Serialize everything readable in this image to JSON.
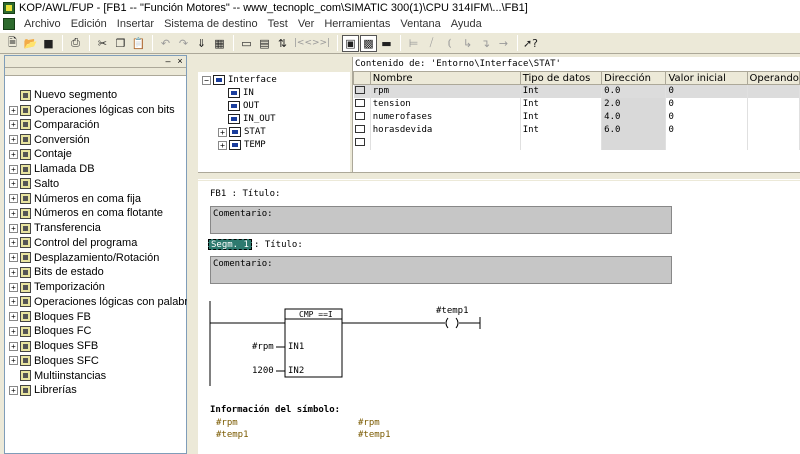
{
  "window": {
    "title": "KOP/AWL/FUP  - [FB1 -- \"Función Motores\" -- www_tecnoplc_com\\SIMATIC 300(1)\\CPU 314IFM\\...\\FB1]"
  },
  "menu": {
    "items": [
      "Archivo",
      "Edición",
      "Insertar",
      "Sistema de destino",
      "Test",
      "Ver",
      "Herramientas",
      "Ventana",
      "Ayuda"
    ]
  },
  "toolbar": {
    "buttons": [
      "new-file-icon",
      "open-folder-icon",
      "save-icon",
      "print-icon",
      "cut-icon",
      "copy-icon",
      "paste-icon",
      "undo-icon",
      "redo-icon",
      "load-icon",
      "download-icon",
      "monitor-icon",
      "network-icon",
      "compare-icon",
      "nav-icon",
      "overview-icon",
      "zoom-icon",
      "contact-no-icon",
      "contact-nc-icon",
      "coil-icon",
      "branch-icon",
      "help-icon"
    ],
    "nav_label": "|<<>>|"
  },
  "catalog": {
    "items": [
      {
        "label": "Nuevo segmento",
        "expandable": false
      },
      {
        "label": "Operaciones lógicas con bits",
        "expandable": true
      },
      {
        "label": "Comparación",
        "expandable": true
      },
      {
        "label": "Conversión",
        "expandable": true
      },
      {
        "label": "Contaje",
        "expandable": true
      },
      {
        "label": "Llamada DB",
        "expandable": true
      },
      {
        "label": "Salto",
        "expandable": true
      },
      {
        "label": "Números en coma fija",
        "expandable": true
      },
      {
        "label": "Números en coma flotante",
        "expandable": true
      },
      {
        "label": "Transferencia",
        "expandable": true
      },
      {
        "label": "Control del programa",
        "expandable": true
      },
      {
        "label": "Desplazamiento/Rotación",
        "expandable": true
      },
      {
        "label": "Bits de estado",
        "expandable": true
      },
      {
        "label": "Temporización",
        "expandable": true
      },
      {
        "label": "Operaciones lógicas con palabra",
        "expandable": true
      },
      {
        "label": "Bloques FB",
        "expandable": true
      },
      {
        "label": "Bloques FC",
        "expandable": true
      },
      {
        "label": "Bloques SFB",
        "expandable": true
      },
      {
        "label": "Bloques SFC",
        "expandable": true
      },
      {
        "label": "Multiinstancias",
        "expandable": false
      },
      {
        "label": "Librerías",
        "expandable": true
      }
    ]
  },
  "interface": {
    "root": "Interface",
    "children": [
      "IN",
      "OUT",
      "IN_OUT",
      "STAT",
      "TEMP"
    ]
  },
  "vartable": {
    "caption": "Contenido de: 'Entorno\\Interface\\STAT'",
    "headers": [
      "Nombre",
      "Tipo de datos",
      "Dirección",
      "Valor inicial",
      "Operando"
    ],
    "rows": [
      {
        "name": "rpm",
        "type": "Int",
        "address": "0.0",
        "init": "0"
      },
      {
        "name": "tension",
        "type": "Int",
        "address": "2.0",
        "init": "0"
      },
      {
        "name": "numerofases",
        "type": "Int",
        "address": "4.0",
        "init": "0"
      },
      {
        "name": "horasdevida",
        "type": "Int",
        "address": "6.0",
        "init": "0"
      }
    ]
  },
  "editor": {
    "block_title": "FB1 : Título:",
    "block_comment": "Comentario:",
    "segment_label": "Segm. 1",
    "segment_title": ": Título:",
    "segment_comment": "Comentario:",
    "cmp_box": "CMP ==I",
    "in1_operand": "#rpm",
    "in1_pin": "IN1",
    "in2_operand": "1200",
    "in2_pin": "IN2",
    "coil_operand": "#temp1",
    "symbol_info_title": "Información del símbolo:",
    "symbol_info": [
      {
        "symbol": "#rpm",
        "value": "#rpm"
      },
      {
        "symbol": "#temp1",
        "value": "#temp1"
      }
    ]
  }
}
